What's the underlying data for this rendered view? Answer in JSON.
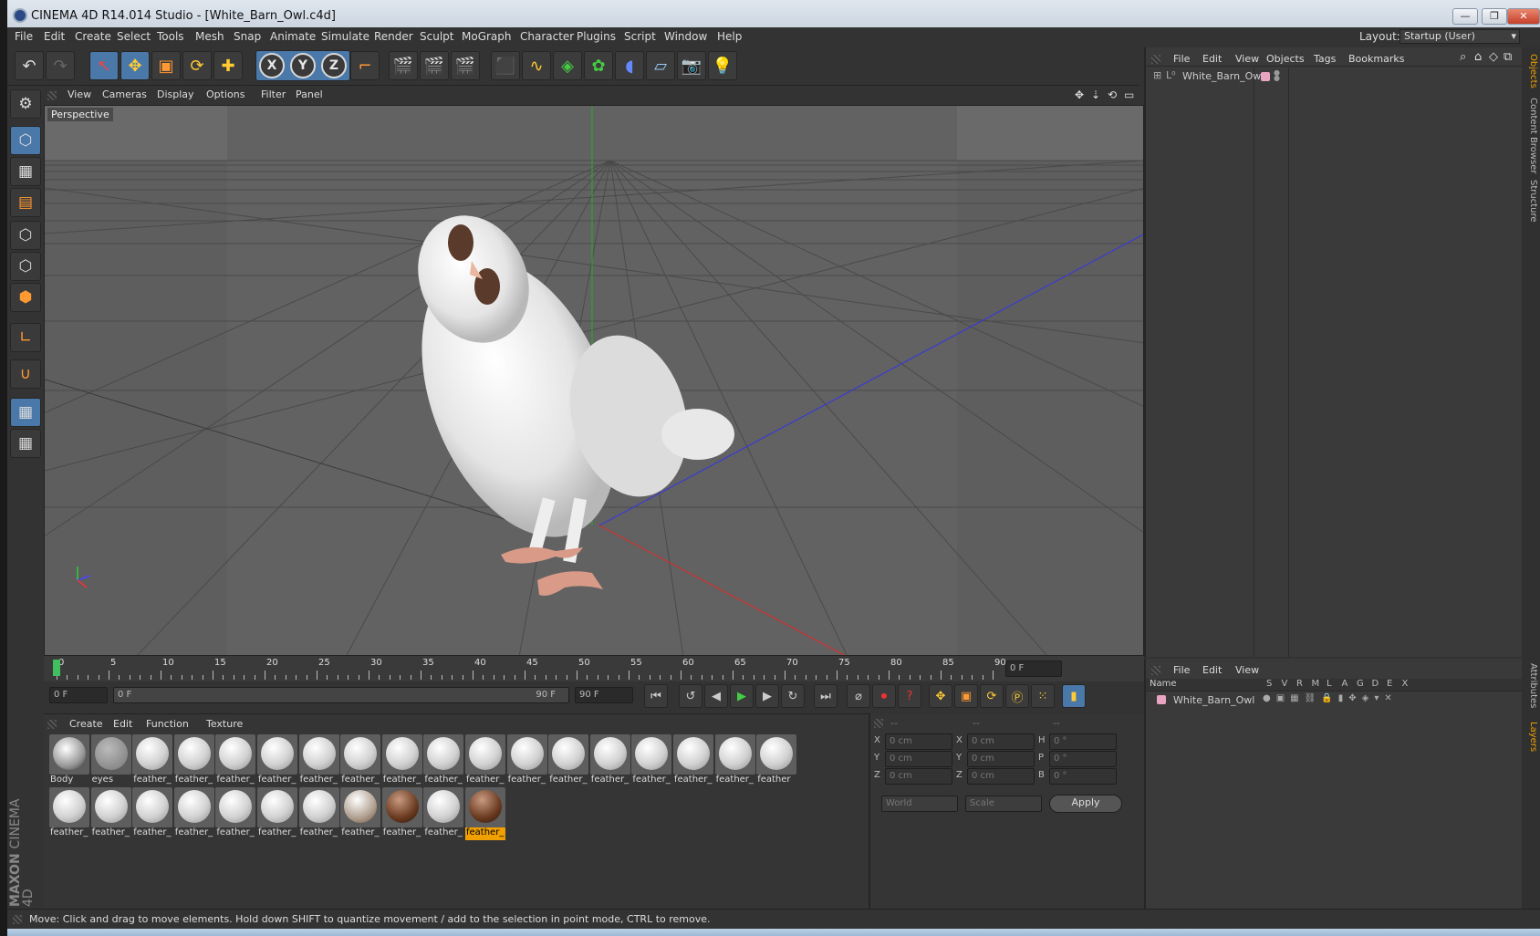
{
  "window": {
    "title": "CINEMA 4D R14.014 Studio - [White_Barn_Owl.c4d]",
    "minimize": "—",
    "restore": "❐",
    "close": "✕"
  },
  "menubar": {
    "items": [
      "File",
      "Edit",
      "Create",
      "Select",
      "Tools",
      "Mesh",
      "Snap",
      "Animate",
      "Simulate",
      "Render",
      "Sculpt",
      "MoGraph",
      "Character",
      "Plugins",
      "Script",
      "Window",
      "Help"
    ],
    "layout_label": "Layout:",
    "layout_value": "Startup (User)"
  },
  "viewport": {
    "menu": [
      "View",
      "Cameras",
      "Display",
      "Options",
      "Filter",
      "Panel"
    ],
    "camera_label": "Perspective",
    "axis_x": "X",
    "axis_y": "Y",
    "axis_z": "Z"
  },
  "timeline": {
    "ticks": [
      "0",
      "5",
      "10",
      "15",
      "20",
      "25",
      "30",
      "35",
      "40",
      "45",
      "50",
      "55",
      "60",
      "65",
      "70",
      "75",
      "80",
      "85",
      "90"
    ],
    "current_frame": "0 F",
    "start_field": "0 F",
    "range_start": "0 F",
    "range_end": "90 F",
    "end_field": "90 F"
  },
  "material_manager": {
    "menu": [
      "Create",
      "Edit",
      "Function",
      "Texture"
    ],
    "row1": [
      "Body",
      "eyes",
      "feather_",
      "feather_",
      "feather_",
      "feather_",
      "feather_",
      "feather_",
      "feather_",
      "feather_",
      "feather_",
      "feather_",
      "feather_",
      "feather_",
      "feather_",
      "feather_",
      "feather_",
      "feather"
    ],
    "row2": [
      "feather_",
      "feather_",
      "feather_",
      "feather_",
      "feather_",
      "feather_",
      "feather_",
      "feather_",
      "feather_",
      "feather_",
      "feather_"
    ],
    "selected_label": "feather_"
  },
  "coordinates": {
    "headers": [
      "--",
      "--",
      "--"
    ],
    "rows": [
      {
        "a": "X",
        "av": "0 cm",
        "b": "X",
        "bv": "0 cm",
        "c": "H",
        "cv": "0 °"
      },
      {
        "a": "Y",
        "av": "0 cm",
        "b": "Y",
        "bv": "0 cm",
        "c": "P",
        "cv": "0 °"
      },
      {
        "a": "Z",
        "av": "0 cm",
        "b": "Z",
        "bv": "0 cm",
        "c": "B",
        "cv": "0 °"
      }
    ],
    "space": "World",
    "mode": "Scale",
    "apply": "Apply"
  },
  "object_manager": {
    "menu": [
      "File",
      "Edit",
      "View",
      "Objects",
      "Tags",
      "Bookmarks"
    ],
    "object_name": "White_Barn_Owl"
  },
  "layer_manager": {
    "menu": [
      "File",
      "Edit",
      "View"
    ],
    "col_name": "Name",
    "cols": [
      "S",
      "V",
      "R",
      "M",
      "L",
      "A",
      "G",
      "D",
      "E",
      "X"
    ],
    "layer_name": "White_Barn_Owl"
  },
  "side_tabs": [
    "Objects",
    "Content Browser",
    "Structure",
    "Attributes",
    "Layers"
  ],
  "brand": {
    "line1": "MAXON",
    "line2": "CINEMA 4D"
  },
  "status": "Move: Click and drag to move elements. Hold down SHIFT to quantize movement / add to the selection in point mode, CTRL to remove.",
  "colors": {
    "accent": "#4a78a8",
    "selected_material": "#f0a000",
    "axis_x": "#c03030",
    "axis_y": "#30a030",
    "axis_z": "#3030c0"
  }
}
